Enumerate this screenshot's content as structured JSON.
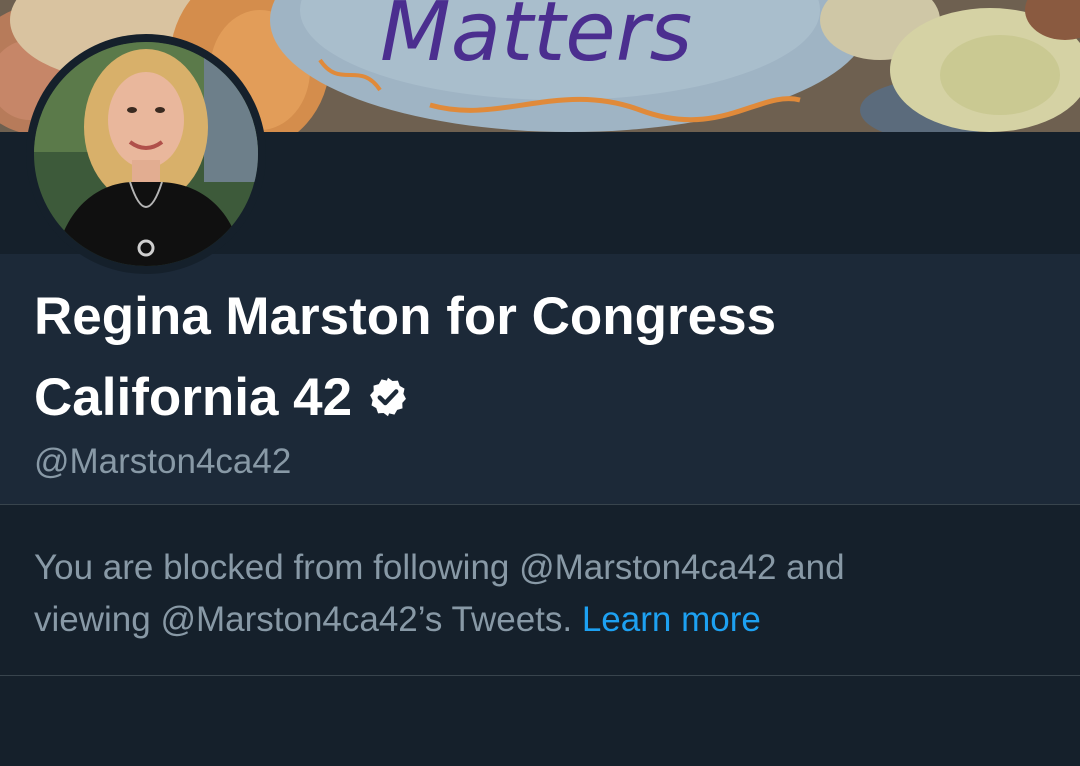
{
  "profile": {
    "display_name_line1": "Regina Marston for Congress",
    "display_name_line2": "California 42",
    "handle": "@Marston4ca42",
    "verified": true
  },
  "blocked_notice": {
    "text_part1": "You are blocked from following @Marston4ca42 and",
    "text_part2": "viewing @Marston4ca42’s Tweets.",
    "link_label": "Learn more"
  },
  "header_image": {
    "lettering": "Matters"
  },
  "icons": {
    "verified": "verified-badge-icon",
    "header": "painted-rocks-banner",
    "avatar": "profile-photo"
  },
  "colors": {
    "background": "#15202b",
    "card": "#1c2938",
    "text_primary": "#ffffff",
    "text_secondary": "#8899a6",
    "link": "#1da1f2",
    "divider": "#38444d"
  }
}
